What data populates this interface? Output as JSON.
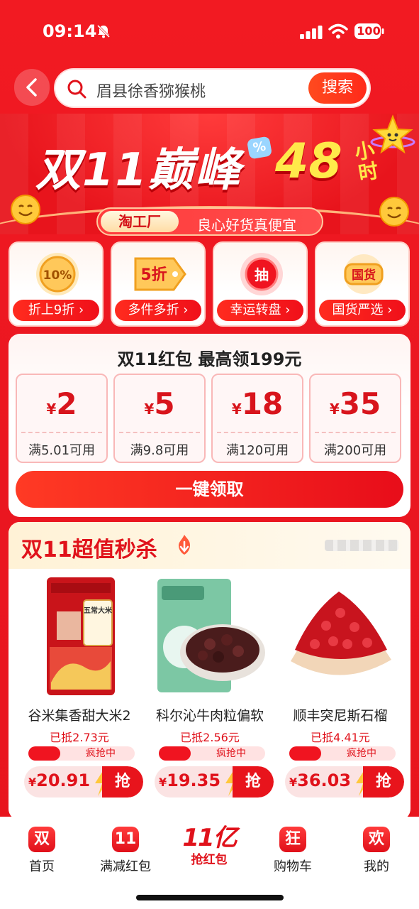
{
  "status_bar": {
    "time": "09:14",
    "battery": "100"
  },
  "search": {
    "query": "眉县徐香猕猴桃",
    "button_label": "搜索"
  },
  "banner": {
    "title": "双11巅峰",
    "hours": "48",
    "hours_unit": "小时",
    "percent_badge": "%",
    "tag": "淘工厂",
    "slogan": "良心好货真便宜"
  },
  "features": [
    {
      "icon_text": "10%",
      "label": "折上9折 ›"
    },
    {
      "icon_text": "5折",
      "label": "多件多折 ›"
    },
    {
      "icon_text": "抽",
      "label": "幸运转盘 ›"
    },
    {
      "icon_text": "国货",
      "label": "国货严选 ›"
    }
  ],
  "red_packet": {
    "title": "双11红包  最高领199元",
    "coupons": [
      {
        "yen": "¥",
        "amount": "2",
        "condition": "满5.01可用"
      },
      {
        "yen": "¥",
        "amount": "5",
        "condition": "满9.8可用"
      },
      {
        "yen": "¥",
        "amount": "18",
        "condition": "满120可用"
      },
      {
        "yen": "¥",
        "amount": "35",
        "condition": "满200可用"
      }
    ],
    "claim_label": "一键领取"
  },
  "flash_sale": {
    "title": "双11超值秒杀",
    "products": [
      {
        "name": "谷米集香甜大米2",
        "deduct": "已抵2.73元",
        "status": "疯抢中",
        "progress": 0.3,
        "yen": "¥",
        "price": "20.91",
        "buy": "抢",
        "image_text": "五常大米"
      },
      {
        "name": "科尔沁牛肉粒偏软",
        "deduct": "已抵2.56元",
        "status": "疯抢中",
        "progress": 0.3,
        "yen": "¥",
        "price": "19.35",
        "buy": "抢"
      },
      {
        "name": "顺丰突尼斯石榴",
        "deduct": "已抵4.41元",
        "status": "疯抢中",
        "progress": 0.3,
        "yen": "¥",
        "price": "36.03",
        "buy": "抢"
      }
    ]
  },
  "tab_bar": {
    "tabs": [
      {
        "icon_text": "双",
        "label": "首页"
      },
      {
        "icon_text": "11",
        "label": "满减红包"
      },
      {
        "big_text": "11亿",
        "label": "抢红包"
      },
      {
        "icon_text": "狂",
        "label": "购物车"
      },
      {
        "icon_text": "欢",
        "label": "我的"
      }
    ]
  },
  "colors": {
    "brand_red": "#e8141c",
    "accent_yellow": "#ffe94a",
    "cream": "#fff2d6"
  }
}
